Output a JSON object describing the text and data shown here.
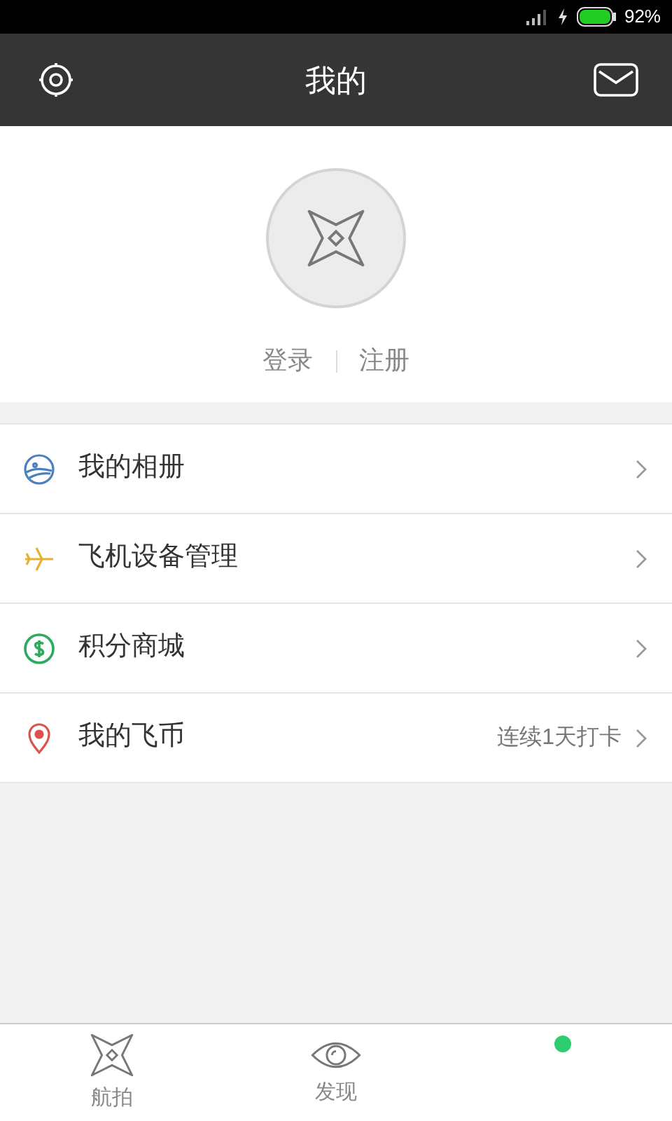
{
  "status_bar": {
    "battery": "92%"
  },
  "header": {
    "title": "我的"
  },
  "profile": {
    "login": "登录",
    "register": "注册"
  },
  "menu": [
    {
      "kind": "album",
      "label": "我的相册"
    },
    {
      "kind": "plane",
      "label": "飞机设备管理"
    },
    {
      "kind": "coin",
      "label": "积分商城"
    },
    {
      "kind": "pin",
      "label": "我的飞币",
      "note": "连续1天打卡"
    }
  ],
  "tabs": [
    {
      "kind": "drone",
      "label": "航拍",
      "selected": false
    },
    {
      "kind": "eye",
      "label": "发现",
      "selected": false
    }
  ],
  "tab_badge": {
    "color": "#2ecc71"
  }
}
